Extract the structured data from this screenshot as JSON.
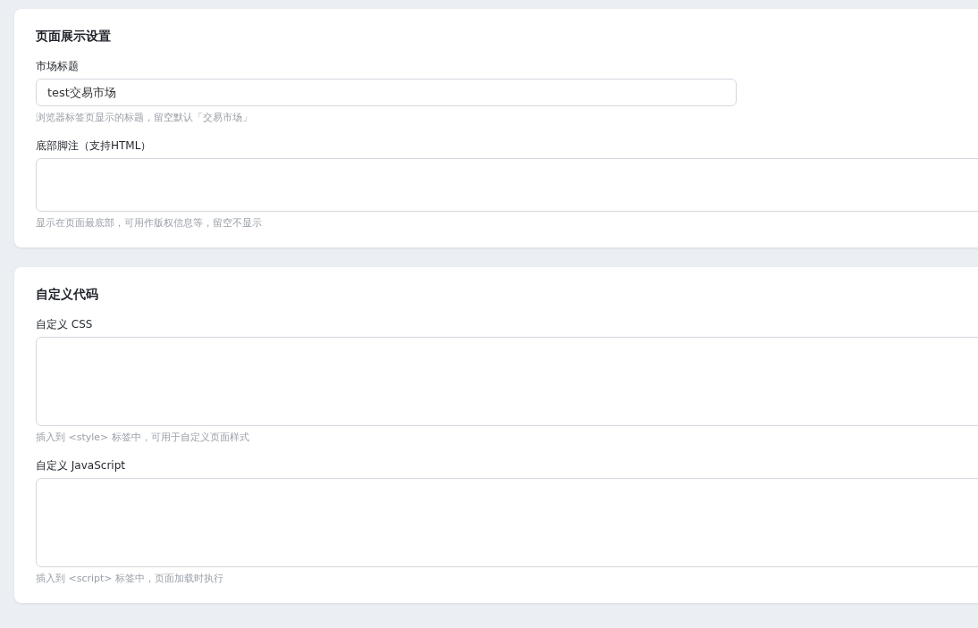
{
  "sections": [
    {
      "title": "页面展示设置",
      "fields": [
        {
          "kind": "input",
          "label": "市场标题",
          "value": "test交易市场",
          "help": "浏览器标签页显示的标题，留空默认「交易市场」"
        },
        {
          "kind": "textarea",
          "label": "底部脚注（支持HTML）",
          "help": "显示在页面最底部，可用作版权信息等，留空不显示"
        }
      ]
    },
    {
      "title": "自定义代码",
      "fields": [
        {
          "kind": "code",
          "label": "自定义 CSS",
          "help": "插入到 <style> 标签中，可用于自定义页面样式"
        },
        {
          "kind": "code",
          "label": "自定义 JavaScript",
          "help": "插入到 <script> 标签中，页面加载时执行"
        }
      ]
    }
  ]
}
